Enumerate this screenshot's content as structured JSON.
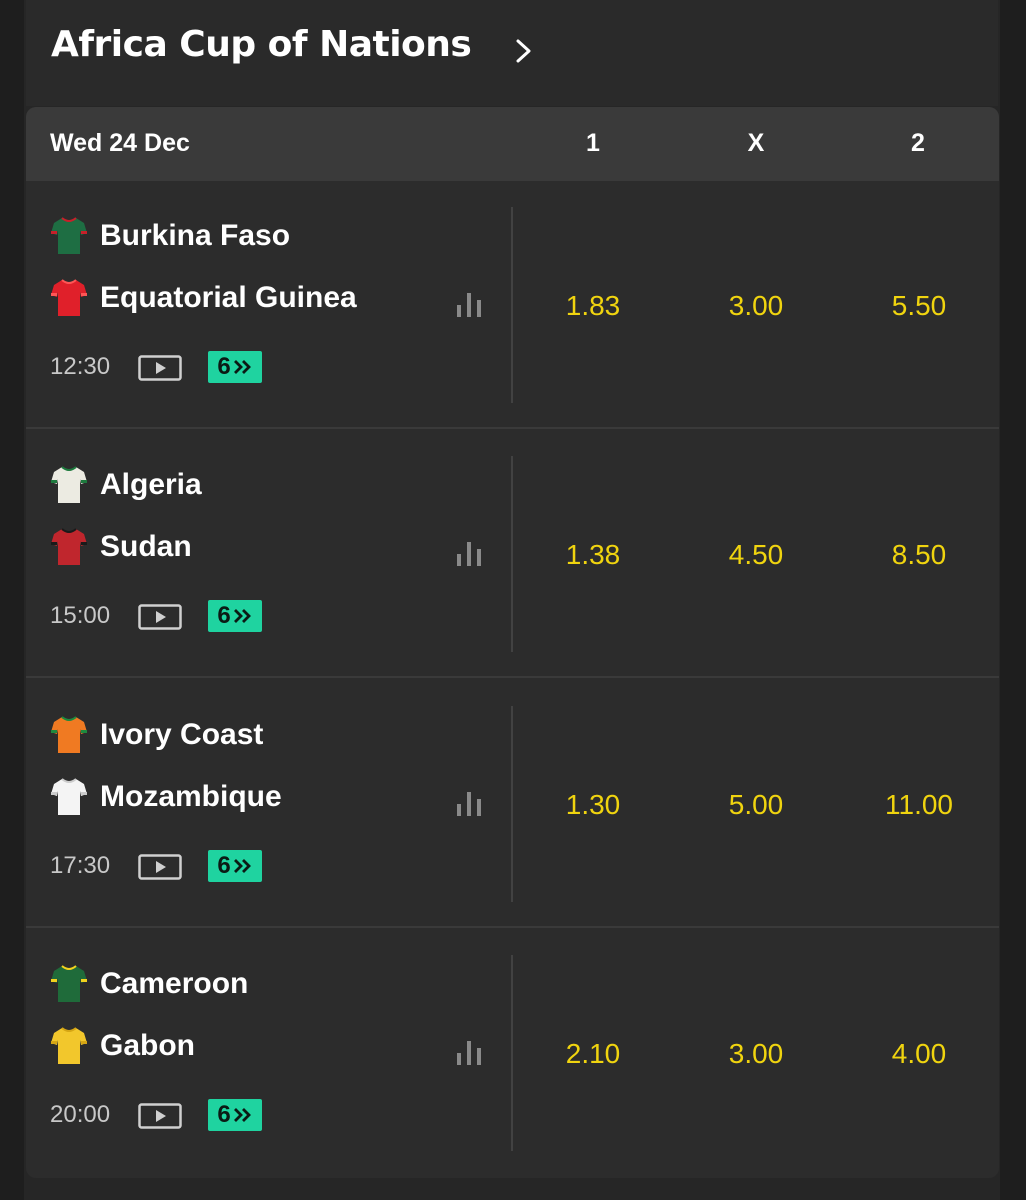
{
  "competition": {
    "title": "Africa Cup of Nations"
  },
  "market_header": {
    "date": "Wed 24 Dec",
    "col_1": "1",
    "col_x": "X",
    "col_2": "2"
  },
  "events": [
    {
      "home": "Burkina Faso",
      "away": "Equatorial Guinea",
      "time": "12:30",
      "boost": "6",
      "odds": {
        "home": "1.83",
        "draw": "3.00",
        "away": "5.50"
      },
      "home_shirt": "#1e6e43",
      "home_accent": "#c8202a",
      "away_shirt": "#e0202a",
      "away_accent": "#ff5555"
    },
    {
      "home": "Algeria",
      "away": "Sudan",
      "time": "15:00",
      "boost": "6",
      "odds": {
        "home": "1.38",
        "draw": "4.50",
        "away": "8.50"
      },
      "home_shirt": "#ecebe2",
      "home_accent": "#1e7a3e",
      "away_shirt": "#c0262d",
      "away_accent": "#1a1a1a"
    },
    {
      "home": "Ivory Coast",
      "away": "Mozambique",
      "time": "17:30",
      "boost": "6",
      "odds": {
        "home": "1.30",
        "draw": "5.00",
        "away": "11.00"
      },
      "home_shirt": "#f07a22",
      "home_accent": "#1e8a3e",
      "away_shirt": "#f4f4f4",
      "away_accent": "#cccccc"
    },
    {
      "home": "Cameroon",
      "away": "Gabon",
      "time": "20:00",
      "boost": "6",
      "odds": {
        "home": "2.10",
        "draw": "3.00",
        "away": "4.00"
      },
      "home_shirt": "#1f6b3a",
      "home_accent": "#f2d21e",
      "away_shirt": "#f2c72c",
      "away_accent": "#d6a614"
    }
  ],
  "colors": {
    "odds": "#f0d40f",
    "boost": "#1fd3a0",
    "background": "#2c2c2c",
    "header": "#3a3a3a"
  },
  "icons": {
    "chevron": "chevron-right-icon",
    "play": "play-icon",
    "stats": "stats-icon",
    "boost": "boost-chevrons-icon"
  }
}
